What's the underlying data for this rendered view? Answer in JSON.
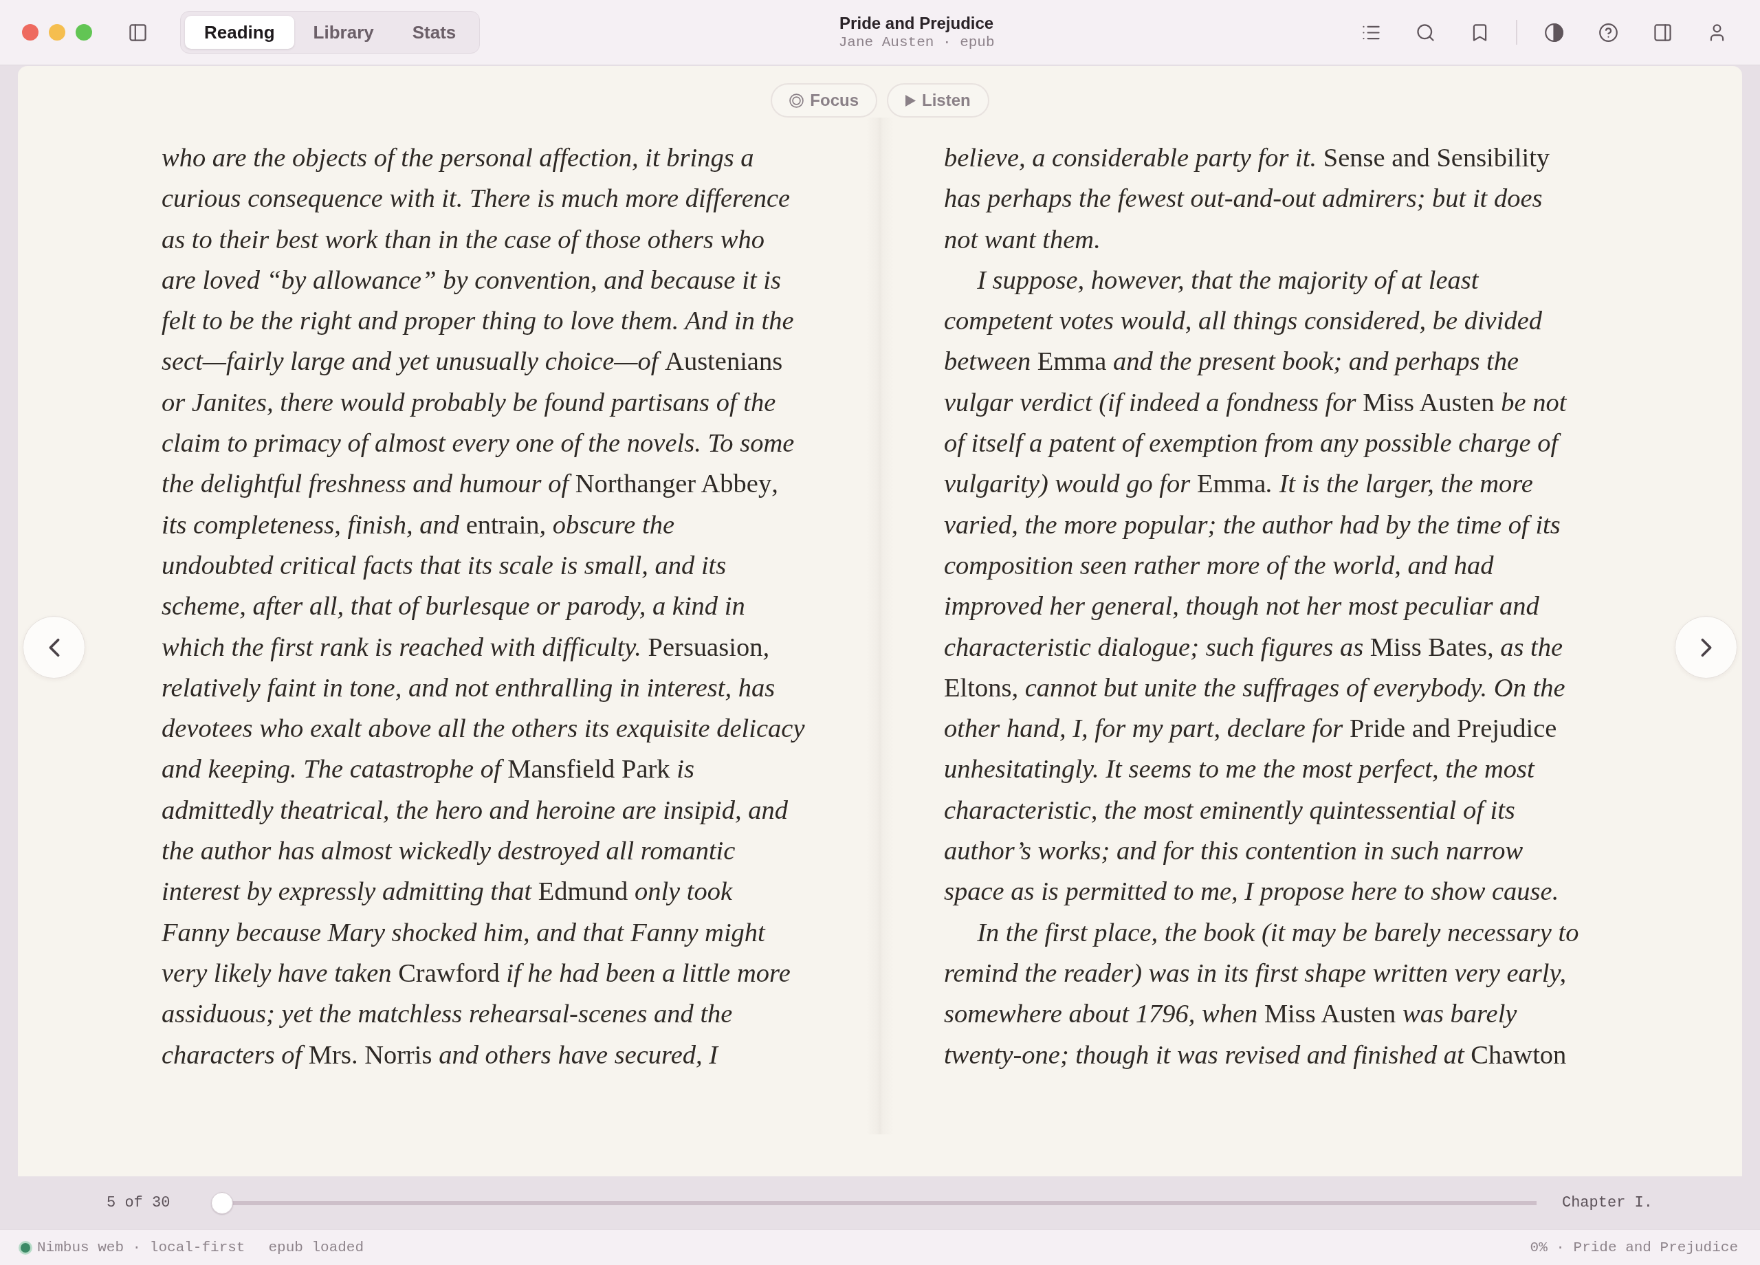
{
  "window": {
    "title": "Pride and Prejudice",
    "subtitle": "Jane Austen · epub"
  },
  "tabs": [
    {
      "label": "Reading",
      "selected": true
    },
    {
      "label": "Library",
      "selected": false
    },
    {
      "label": "Stats",
      "selected": false
    }
  ],
  "reader_actions": [
    {
      "kind": "focus",
      "label": "Focus"
    },
    {
      "kind": "listen",
      "label": "Listen"
    }
  ],
  "pages": [
    {
      "paragraphs": [
        {
          "indent": false,
          "text": "who are the objects of the personal affection, it brings a\ncurious consequence with it. There is much more difference\nas to their best work than in the case of those others who\nare loved “by allowance” by convention, and because it is\nfelt to be the right and proper thing to love them. And in the\nsect—fairly large and yet unusually choice—of *Austenians*\nor Janites, there would probably be found partisans of the\nclaim to primacy of almost every one of the novels. To some\nthe delightful freshness and humour of *Northanger Abbey*,\nits completeness, finish, and *entrain*, obscure the\nundoubted critical facts that its scale is small, and its\nscheme, after all, that of burlesque or parody, a kind in\nwhich the first rank is reached with difficulty. *Persuasion*,\nrelatively faint in tone, and not enthralling in interest, has\ndevotees who exalt above all the others its exquisite delicacy\nand keeping. The catastrophe of *Mansfield Park* is\nadmittedly theatrical, the hero and heroine are insipid, and\nthe author has almost wickedly destroyed all romantic\ninterest by expressly admitting that *Edmund* only took\nFanny because Mary shocked him, and that Fanny might\nvery likely have taken *Crawford* if he had been a little more\nassiduous; yet the matchless rehearsal-scenes and the\ncharacters of *Mrs. Norris* and others have secured, I"
        }
      ]
    },
    {
      "paragraphs": [
        {
          "indent": false,
          "text": "believe, a considerable party for it. *Sense and Sensibility*\nhas perhaps the fewest out-and-out admirers; but it does\nnot want them."
        },
        {
          "indent": true,
          "text": "I suppose, however, that the majority of at least\ncompetent votes would, all things considered, be divided\nbetween *Emma* and the present book; and perhaps the\nvulgar verdict (if indeed a fondness for *Miss Austen* be not\nof itself a patent of exemption from any possible charge of\nvulgarity) would go for *Emma*. It is the larger, the more\nvaried, the more popular; the author had by the time of its\ncomposition seen rather more of the world, and had\nimproved her general, though not her most peculiar and\ncharacteristic dialogue; such figures as *Miss Bates*, as the\n*Eltons*, cannot but unite the suffrages of everybody. On the\nother hand, I, for my part, declare for *Pride and Prejudice*\nunhesitatingly. It seems to me the most perfect, the most\ncharacteristic, the most eminently quintessential of its\nauthor’s works; and for this contention in such narrow\nspace as is permitted to me, I propose here to show cause."
        },
        {
          "indent": true,
          "text": "In the first place, the book (it may be barely necessary to\nremind the reader) was in its first shape written very early,\nsomewhere about 1796, when *Miss Austen* was barely\ntwenty-one; though it was revised and finished at *Chawton*"
        }
      ]
    }
  ],
  "progress": {
    "position": "5 of 30",
    "level": 0,
    "chapter": "Chapter I."
  },
  "status_bar": {
    "left": [
      "Nimbus web · local-first",
      "epub loaded"
    ],
    "right": "0% · Pride and Prejudice"
  }
}
